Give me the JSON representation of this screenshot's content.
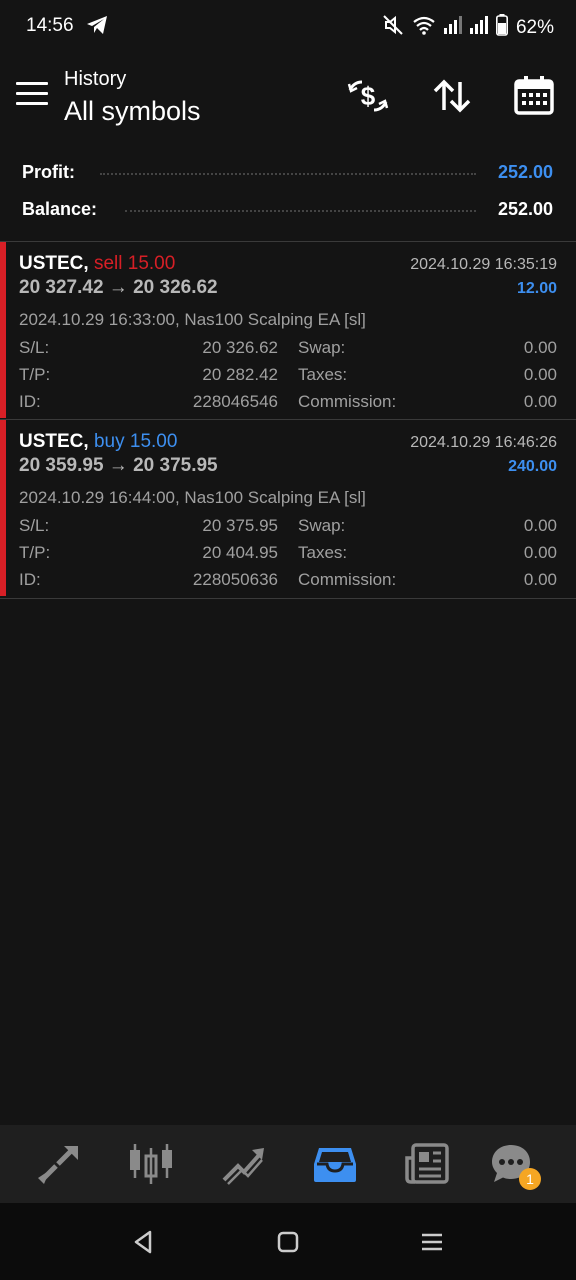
{
  "status_bar": {
    "time": "14:56",
    "battery": "62%"
  },
  "header": {
    "subtitle": "History",
    "title": "All symbols",
    "icons": [
      "currency-exchange-icon",
      "sort-icon",
      "calendar-icon"
    ]
  },
  "summary": {
    "profit_label": "Profit:",
    "profit_value": "252.00",
    "balance_label": "Balance:",
    "balance_value": "252.00"
  },
  "deals": [
    {
      "symbol": "USTEC,",
      "side": "sell 15.00",
      "side_color": "#d71f26",
      "prices": "20 327.42 → 20 326.62",
      "close_time": "2024.10.29 16:35:19",
      "profit": "12.00",
      "comment": "2024.10.29 16:33:00, Nas100 Scalping EA [sl]",
      "sl_label": "S/L:",
      "sl_value": "20 326.62",
      "tp_label": "T/P:",
      "tp_value": "20 282.42",
      "id_label": "ID:",
      "id_value": "228046546",
      "swap_label": "Swap:",
      "swap_value": "0.00",
      "taxes_label": "Taxes:",
      "taxes_value": "0.00",
      "commission_label": "Commission:",
      "commission_value": "0.00"
    },
    {
      "symbol": "USTEC,",
      "side": "buy 15.00",
      "side_color": "#3d8ff0",
      "prices": "20 359.95 → 20 375.95",
      "close_time": "2024.10.29 16:46:26",
      "profit": "240.00",
      "comment": "2024.10.29 16:44:00, Nas100 Scalping EA [sl]",
      "sl_label": "S/L:",
      "sl_value": "20 375.95",
      "tp_label": "T/P:",
      "tp_value": "20 404.95",
      "id_label": "ID:",
      "id_value": "228050636",
      "swap_label": "Swap:",
      "swap_value": "0.00",
      "taxes_label": "Taxes:",
      "taxes_value": "0.00",
      "commission_label": "Commission:",
      "commission_value": "0.00"
    }
  ],
  "bottom_nav": {
    "items": [
      "quotes-icon",
      "chart-icon",
      "trade-icon",
      "history-icon",
      "news-icon",
      "chat-icon"
    ],
    "active": "history-icon",
    "chat_badge": "1",
    "active_color": "#3d8ff0",
    "badge_color": "#f5a623"
  },
  "colors": {
    "sell": "#d71f26",
    "buy": "#3d8ff0",
    "profit_positive": "#3d8ff0"
  }
}
